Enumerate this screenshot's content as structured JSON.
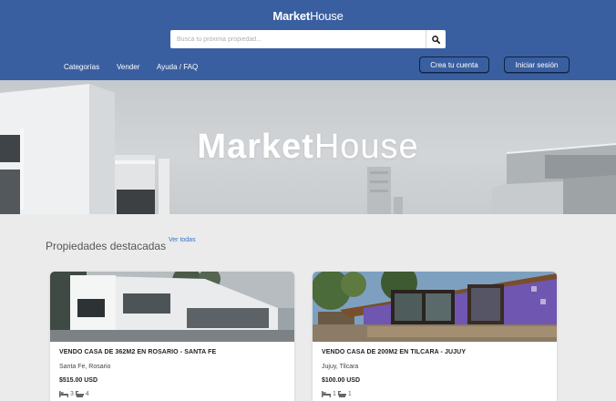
{
  "header": {
    "logo_bold": "Market",
    "logo_rest": "House",
    "search": {
      "placeholder": "Buscá tu próxima propiedad..."
    },
    "nav": [
      "Categorías",
      "Vender",
      "Ayuda / FAQ"
    ],
    "signup_label": "Crea tu cuenta",
    "login_label": "Iniciar sesión"
  },
  "hero": {
    "title_bold": "Market",
    "title_rest": "House"
  },
  "section": {
    "title": "Propiedades destacadas",
    "see_all": "Ver todas"
  },
  "listings": [
    {
      "title": "VENDO CASA DE 362M2 EN ROSARIO - SANTA FE",
      "location": "Santa Fe, Rosario",
      "price": "$515.00 USD",
      "beds": "3",
      "baths": "4"
    },
    {
      "title": "VENDO CASA DE 200M2 EN TILCARA - JUJUY",
      "location": "Jujuy, Tilcara",
      "price": "$100.00 USD",
      "beds": "1",
      "baths": "1"
    }
  ],
  "colors": {
    "header": "#3a5fa0",
    "link": "#3a72c8",
    "page_bg": "#ebebeb"
  },
  "icons": [
    "search-icon",
    "bed-icon",
    "bath-icon"
  ]
}
